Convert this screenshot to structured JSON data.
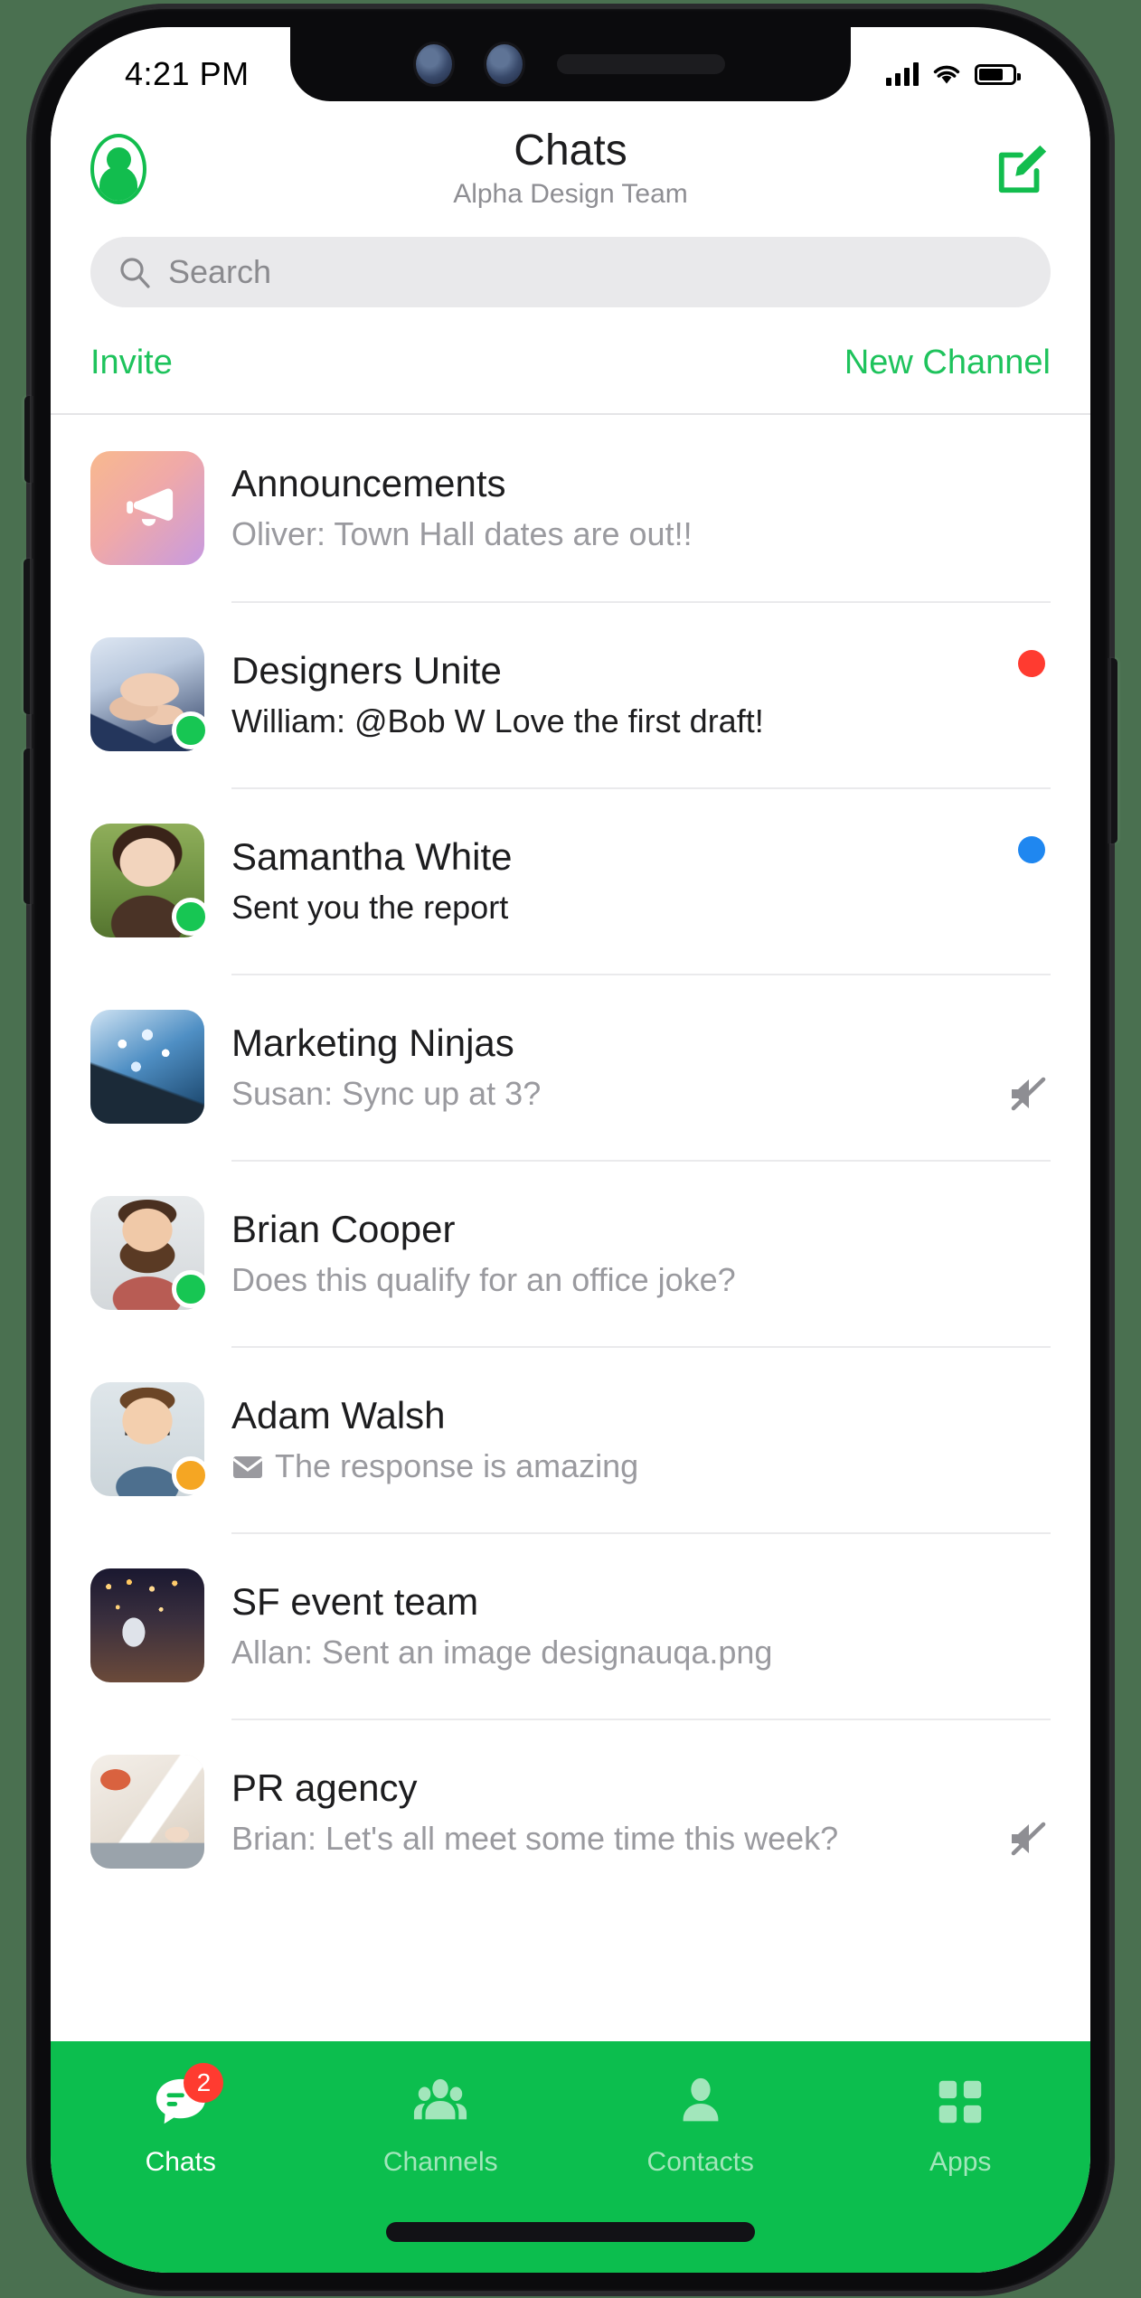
{
  "status_bar": {
    "time": "4:21 PM",
    "signal_icon": "signal-bars-icon",
    "wifi_icon": "wifi-icon",
    "battery_icon": "battery-icon",
    "battery_level_pct": 72
  },
  "header": {
    "profile_icon": "profile-avatar-icon",
    "title": "Chats",
    "subtitle": "Alpha Design Team",
    "compose_icon": "compose-icon"
  },
  "search": {
    "icon": "search-icon",
    "placeholder": "Search",
    "value": ""
  },
  "actions": {
    "invite_label": "Invite",
    "new_channel_label": "New Channel"
  },
  "colors": {
    "accent_green": "#0cbe4e",
    "link_green": "#1ec35c",
    "unread_red": "#ff3b30",
    "mention_blue": "#1f87f0",
    "online_green": "#17c653",
    "away_orange": "#f5a623",
    "muted_gray": "#9a9a9f"
  },
  "chats": [
    {
      "name": "Announcements",
      "preview": "Oliver: Town Hall dates are out!!",
      "preview_style": "muted",
      "avatar": "megaphone-icon",
      "presence": null,
      "badge": null,
      "muted": false,
      "attachment_icon": null
    },
    {
      "name": "Designers Unite",
      "preview": "William: @Bob W Love the first draft!",
      "preview_style": "dark",
      "avatar": "team-hands-photo",
      "presence": "online",
      "badge": "unread-red",
      "muted": false,
      "attachment_icon": null
    },
    {
      "name": "Samantha White",
      "preview": "Sent you the report",
      "preview_style": "dark",
      "avatar": "samantha-photo",
      "presence": "online",
      "badge": "mention-blue",
      "muted": false,
      "attachment_icon": null
    },
    {
      "name": "Marketing Ninjas",
      "preview": "Susan: Sync up at 3?",
      "preview_style": "muted",
      "avatar": "marketing-photo",
      "presence": null,
      "badge": null,
      "muted": true,
      "attachment_icon": null
    },
    {
      "name": "Brian Cooper",
      "preview": "Does this qualify for an office joke?",
      "preview_style": "muted",
      "avatar": "brian-photo",
      "presence": "online",
      "badge": null,
      "muted": false,
      "attachment_icon": null
    },
    {
      "name": "Adam Walsh",
      "preview": "The response is amazing",
      "preview_style": "muted",
      "avatar": "adam-photo",
      "presence": "away",
      "badge": null,
      "muted": false,
      "attachment_icon": "envelope-icon"
    },
    {
      "name": "SF event team",
      "preview": "Allan: Sent an image designauqa.png",
      "preview_style": "muted",
      "avatar": "sf-event-photo",
      "presence": null,
      "badge": null,
      "muted": false,
      "attachment_icon": null
    },
    {
      "name": "PR agency",
      "preview": "Brian: Let's all meet some time this week?",
      "preview_style": "muted",
      "avatar": "pr-agency-photo",
      "presence": null,
      "badge": null,
      "muted": true,
      "attachment_icon": null
    }
  ],
  "tab_bar": [
    {
      "label": "Chats",
      "icon": "chat-bubble-icon",
      "active": true,
      "badge": "2"
    },
    {
      "label": "Channels",
      "icon": "people-group-icon",
      "active": false,
      "badge": null
    },
    {
      "label": "Contacts",
      "icon": "person-icon",
      "active": false,
      "badge": null
    },
    {
      "label": "Apps",
      "icon": "grid-apps-icon",
      "active": false,
      "badge": null
    }
  ]
}
